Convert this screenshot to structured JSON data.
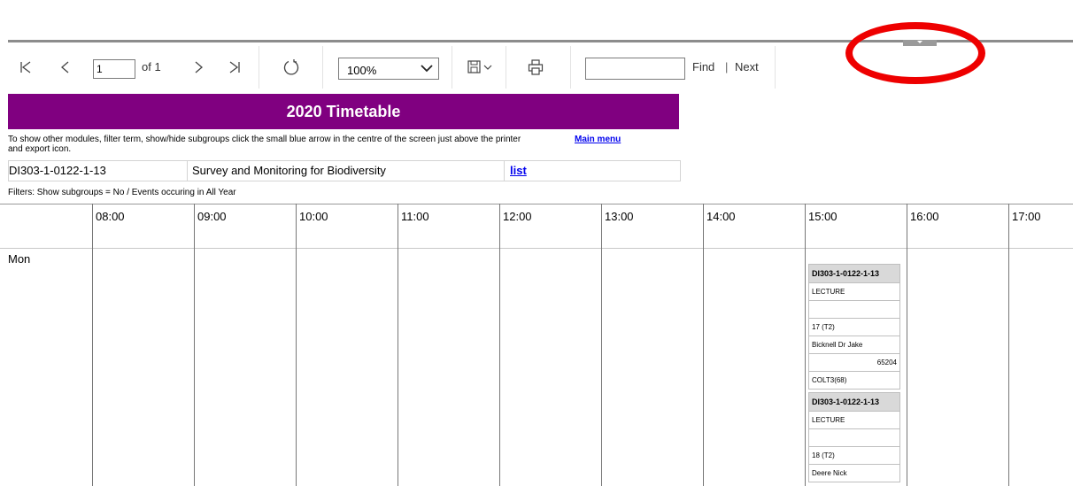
{
  "toolbar": {
    "page_value": "1",
    "page_of": "of 1",
    "zoom": "100%",
    "find_value": "",
    "find_label": "Find",
    "separator": "|",
    "next_label": "Next"
  },
  "report": {
    "title": "2020 Timetable",
    "instructions": "To show other modules, filter term, show/hide subgroups click the small blue arrow in the centre of the screen just above the printer and export icon.",
    "main_menu": "Main menu",
    "module_code": "DI303-1-0122-1-13",
    "module_title": "Survey and Monitoring for Biodiversity",
    "list_link": "list",
    "filters": "Filters: Show subgroups = No / Events occuring in All Year"
  },
  "timetable": {
    "hours": [
      "08:00",
      "09:00",
      "10:00",
      "11:00",
      "12:00",
      "13:00",
      "14:00",
      "15:00",
      "16:00",
      "17:00"
    ],
    "days": [
      "Mon"
    ],
    "events": [
      {
        "code": "DI303-1-0122-1-13",
        "type": "LECTURE",
        "blank": "",
        "weeks": "17 (T2)",
        "staff": "Bicknell Dr Jake",
        "number": "65204",
        "room": "COLT3(68)"
      },
      {
        "code": "DI303-1-0122-1-13",
        "type": "LECTURE",
        "blank": "",
        "weeks": "18 (T2)",
        "staff": "Deere Nick"
      }
    ]
  },
  "colors": {
    "title_bar": "#800080",
    "annotation": "#ee0000",
    "link": "#0000ee",
    "event_header": "#d9d9d9"
  }
}
